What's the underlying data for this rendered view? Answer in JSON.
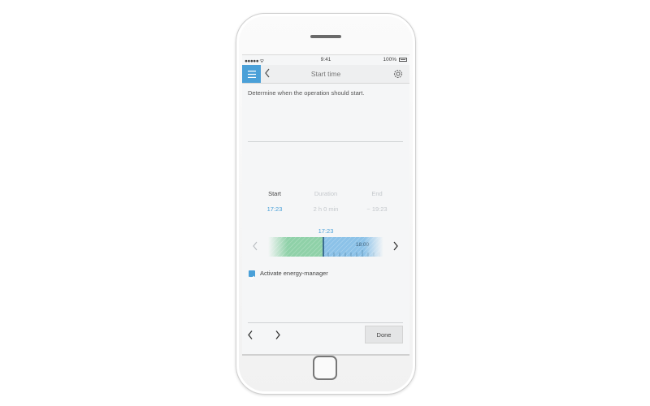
{
  "status_bar": {
    "signal": "●●●●● ᯤ",
    "time": "9:41",
    "battery_pct": "100%"
  },
  "header": {
    "title": "Start time"
  },
  "description": "Determine when the operation should start.",
  "schedule": {
    "columns": [
      {
        "label": "Start",
        "value": "17:23"
      },
      {
        "label": "Duration",
        "value": "2 h 0 min"
      },
      {
        "label": "End",
        "value": "~ 19:23"
      }
    ]
  },
  "timeline": {
    "selected_label": "17:23",
    "tick_label": "18:00"
  },
  "energy_manager": {
    "label": "Activate energy-manager",
    "checked": true
  },
  "footer": {
    "done_label": "Done"
  },
  "colors": {
    "accent": "#4aa0d8",
    "green_zone": "#8fd1a8",
    "blue_zone": "#8cc2e8"
  }
}
